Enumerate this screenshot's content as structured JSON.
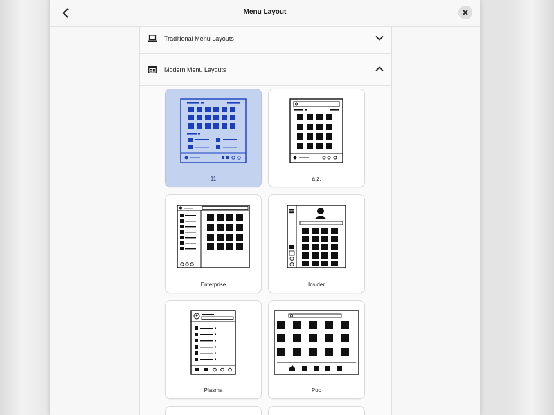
{
  "window": {
    "title": "Menu Layout"
  },
  "sections": [
    {
      "label": "Traditional Menu Layouts",
      "expanded": false
    },
    {
      "label": "Modern Menu Layouts",
      "expanded": true
    }
  ],
  "layouts": [
    {
      "label": "11",
      "selected": true
    },
    {
      "label": "a.z.",
      "selected": false
    },
    {
      "label": "Enterprise",
      "selected": false
    },
    {
      "label": "Insider",
      "selected": false
    },
    {
      "label": "Plasma",
      "selected": false
    },
    {
      "label": "Pop",
      "selected": false
    }
  ],
  "colors": {
    "accent": "#1a3fc0",
    "selected_bg": "#c3d3ef",
    "selected_label": "#2a3f7a"
  },
  "icons": {
    "back": "chevron-left-icon",
    "close": "close-icon",
    "traditional": "laptop-icon",
    "modern": "window-layout-icon",
    "collapsed": "chevron-down-icon",
    "expanded": "chevron-up-icon"
  }
}
